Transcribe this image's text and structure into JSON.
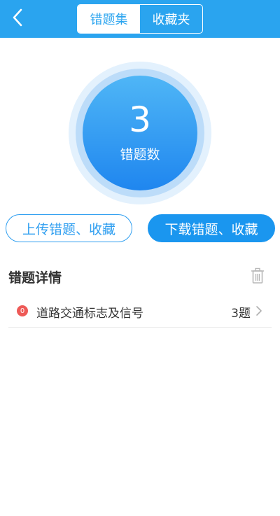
{
  "header": {
    "tabs": [
      {
        "label": "错题集",
        "active": true
      },
      {
        "label": "收藏夹",
        "active": false
      }
    ]
  },
  "summary": {
    "count": "3",
    "label": "错题数"
  },
  "actions": {
    "upload_label": "上传错题、收藏",
    "download_label": "下载错题、收藏"
  },
  "details": {
    "title": "错题详情",
    "items": [
      {
        "badge": "0",
        "name": "道路交通标志及信号",
        "count": "3题"
      }
    ]
  },
  "colors": {
    "header_bg": "#2aa4ef",
    "accent": "#1a96ef",
    "badge": "#ee5a57"
  },
  "icons": [
    "back-arrow-icon",
    "trash-icon",
    "chevron-right-icon"
  ]
}
